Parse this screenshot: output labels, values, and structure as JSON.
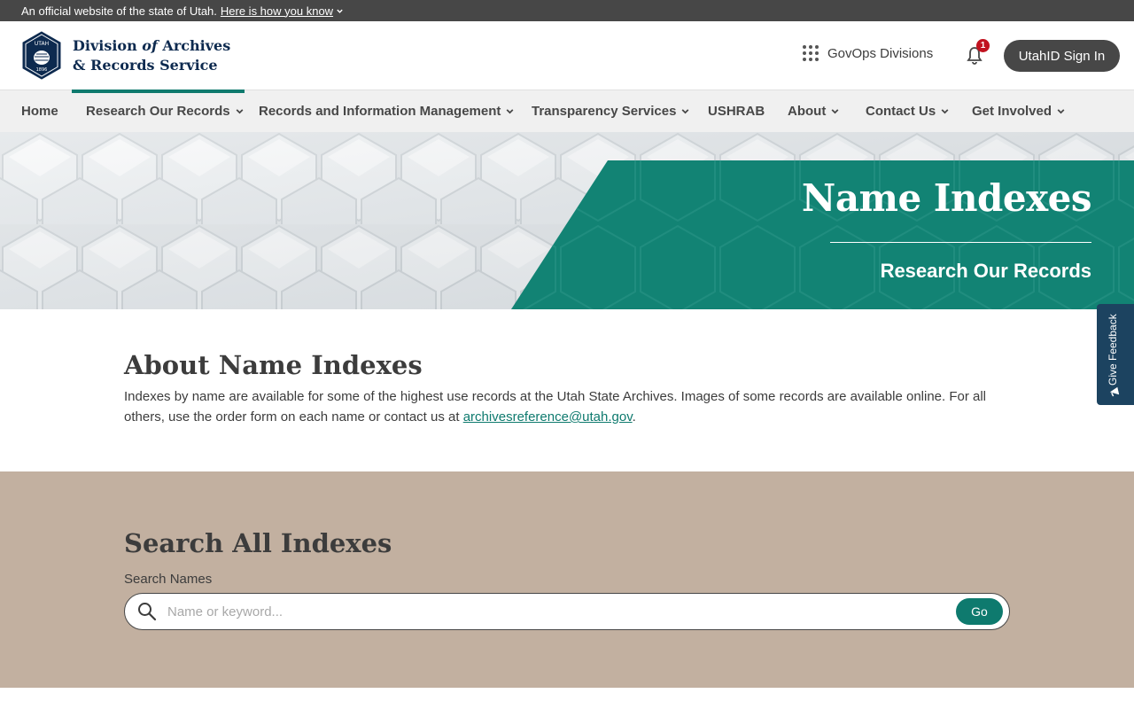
{
  "official_bar": {
    "text": "An official website of the state of Utah.",
    "link": "Here is how you know"
  },
  "header": {
    "logo_line1_a": "Division ",
    "logo_line1_b": "of",
    "logo_line1_c": " Archives",
    "logo_line2": "& Records Service",
    "seal_text_top": "UTAH",
    "seal_text_bottom": "1896",
    "govops_label": "GovOps Divisions",
    "notification_count": "1",
    "signin_label": "UtahID Sign In"
  },
  "nav": {
    "items": [
      {
        "label": "Home",
        "dropdown": false
      },
      {
        "label": "Research Our Records",
        "dropdown": true,
        "active": true
      },
      {
        "label": "Records and Information Management",
        "dropdown": true
      },
      {
        "label": "Transparency Services",
        "dropdown": true
      },
      {
        "label": "USHRAB",
        "dropdown": false
      },
      {
        "label": "About",
        "dropdown": true
      },
      {
        "label": "Contact Us",
        "dropdown": true
      },
      {
        "label": "Get Involved",
        "dropdown": true
      }
    ]
  },
  "hero": {
    "title": "Name Indexes",
    "subtitle": "Research Our Records"
  },
  "feedback": {
    "label": "Give Feedback"
  },
  "about": {
    "title": "About Name Indexes",
    "body": "Indexes by name are available for some of the highest use records at the Utah State Archives. Images of some records are available online. For all others, use the order form on each name or contact us at ",
    "email": "archivesreference@utah.gov",
    "body_end": "."
  },
  "search": {
    "title": "Search All Indexes",
    "label": "Search Names",
    "placeholder": "Name or keyword...",
    "value": "",
    "button": "Go"
  },
  "colors": {
    "accent": "#0e7a6e",
    "banner": "#474747",
    "search_bg": "#c2b0a0",
    "feedback_bg": "#1c4360",
    "brand_navy": "#0d2a4f"
  }
}
